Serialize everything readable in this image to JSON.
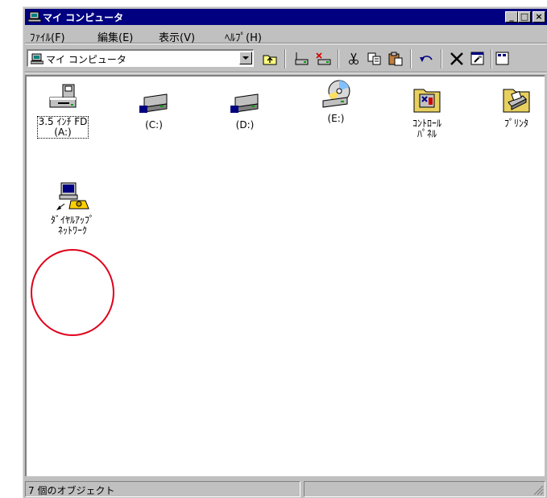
{
  "window": {
    "title": "マイ コンピュータ",
    "controls": {
      "minimize": "_",
      "maximize": "□",
      "close": "×"
    }
  },
  "menubar": {
    "items": [
      {
        "label": "ﾌｧｲﾙ(F)"
      },
      {
        "label": "編集(E)"
      },
      {
        "label": "表示(V)"
      },
      {
        "label": "ﾍﾙﾌﾟ(H)"
      }
    ]
  },
  "toolbar": {
    "address_value": "マイ コンピュータ",
    "buttons": [
      {
        "icon": "up-folder-icon"
      },
      {
        "icon": "map-drive-icon"
      },
      {
        "icon": "disconnect-drive-icon"
      },
      {
        "icon": "cut-icon"
      },
      {
        "icon": "copy-icon"
      },
      {
        "icon": "paste-icon"
      },
      {
        "icon": "undo-icon"
      },
      {
        "icon": "delete-icon"
      },
      {
        "icon": "properties-icon"
      }
    ]
  },
  "content": {
    "items": [
      {
        "label": "3.5 ｲﾝﾁ FD\n(A:)",
        "icon": "floppy-drive-icon",
        "selected": true
      },
      {
        "label": "(C:)",
        "icon": "hard-drive-icon"
      },
      {
        "label": "(D:)",
        "icon": "hard-drive-icon"
      },
      {
        "label": "(E:)",
        "icon": "cd-drive-icon"
      },
      {
        "label": "ｺﾝﾄﾛｰﾙ\nﾊﾟﾈﾙ",
        "icon": "control-panel-icon"
      },
      {
        "label": "ﾌﾟﾘﾝﾀ",
        "icon": "printers-folder-icon"
      },
      {
        "label": "ﾀﾞｲﾔﾙｱｯﾌﾟ\nﾈｯﾄﾜｰｸ",
        "icon": "dialup-networking-icon",
        "highlighted": true
      }
    ]
  },
  "statusbar": {
    "text": "7 個のオブジェクト"
  },
  "colors": {
    "titlebar": "#000080",
    "face": "#c0c0c0",
    "highlight_circle": "#e0001a"
  }
}
